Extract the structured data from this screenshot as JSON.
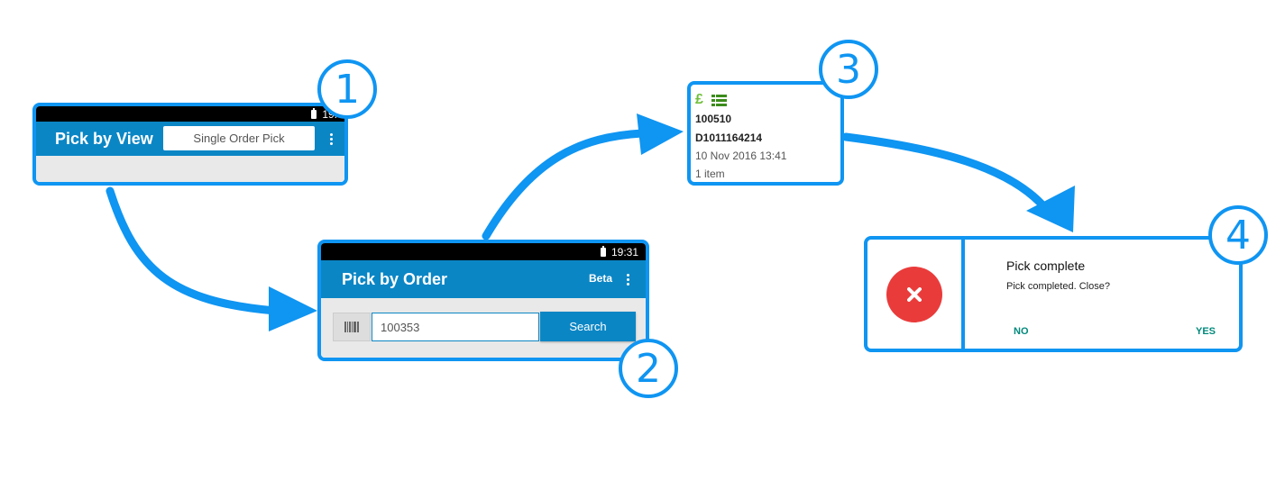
{
  "colors": {
    "accent": "#0f95f2",
    "appbar": "#0b86c5",
    "danger": "#ea3b3b",
    "teal": "#00897b",
    "green": "#4caf50"
  },
  "step1": {
    "badge": "1",
    "status_time": "19:",
    "title": "Pick by View",
    "mode_label": "Single Order Pick"
  },
  "step2": {
    "badge": "2",
    "status_time": "19:31",
    "title": "Pick by Order",
    "beta_label": "Beta",
    "search_value": "100353",
    "search_button": "Search"
  },
  "step3": {
    "badge": "3",
    "currency_symbol": "£",
    "order_number": "100510",
    "order_ref": "D1011164214",
    "date": "10 Nov 2016 13:41",
    "items": "1 item"
  },
  "step4": {
    "badge": "4",
    "title": "Pick complete",
    "message": "Pick completed. Close?",
    "no_label": "NO",
    "yes_label": "YES"
  }
}
